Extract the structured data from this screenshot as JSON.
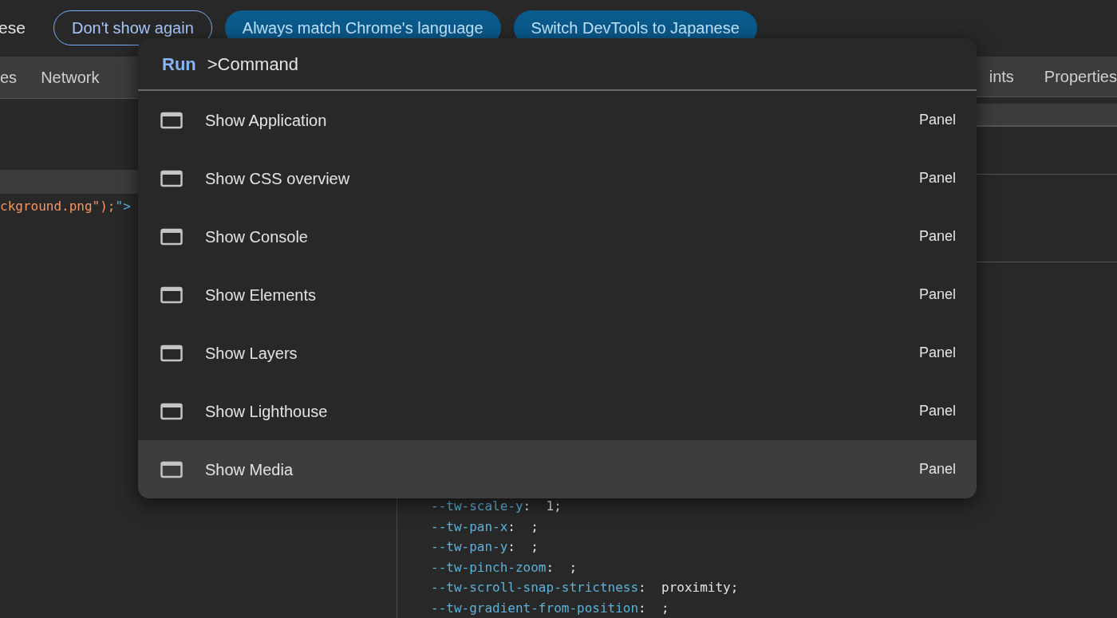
{
  "infobar": {
    "message": "ese",
    "buttons": [
      {
        "label": "Don't show again",
        "kind": "outline"
      },
      {
        "label": "Always match Chrome's language",
        "kind": "filled"
      },
      {
        "label": "Switch DevTools to Japanese",
        "kind": "filled"
      }
    ]
  },
  "main_tabs": [
    {
      "label": "es"
    },
    {
      "label": "Network"
    }
  ],
  "side_tabs": [
    {
      "label": "ints"
    },
    {
      "label": "Properties"
    }
  ],
  "elements": {
    "code_line": [
      {
        "text": "ckground.png\");",
        "kind": "string"
      },
      {
        "text": "\">",
        "kind": "tag"
      }
    ]
  },
  "styles": {
    "declarations": [
      {
        "property": "--tw-scale-y",
        "value": ":  1;"
      },
      {
        "property": "--tw-pan-x",
        "value": ":  ;"
      },
      {
        "property": "--tw-pan-y",
        "value": ":  ;"
      },
      {
        "property": "--tw-pinch-zoom",
        "value": ":  ;"
      },
      {
        "property": "--tw-scroll-snap-strictness",
        "value": ":  proximity;"
      },
      {
        "property": "--tw-gradient-from-position",
        "value": ":  ;"
      }
    ]
  },
  "command_menu": {
    "prefix": "Run",
    "query": ">Command",
    "items": [
      {
        "label": "Show Application",
        "tag": "Panel",
        "selected": false
      },
      {
        "label": "Show CSS overview",
        "tag": "Panel",
        "selected": false
      },
      {
        "label": "Show Console",
        "tag": "Panel",
        "selected": false
      },
      {
        "label": "Show Elements",
        "tag": "Panel",
        "selected": false
      },
      {
        "label": "Show Layers",
        "tag": "Panel",
        "selected": false
      },
      {
        "label": "Show Lighthouse",
        "tag": "Panel",
        "selected": false
      },
      {
        "label": "Show Media",
        "tag": "Panel",
        "selected": true
      }
    ]
  }
}
